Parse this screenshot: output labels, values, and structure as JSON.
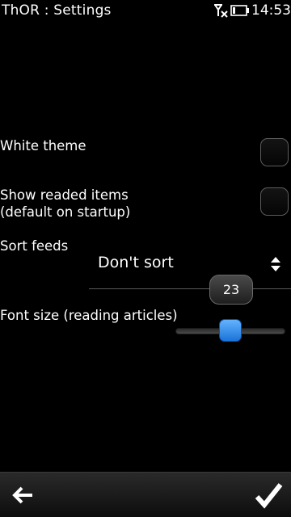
{
  "status_bar": {
    "app_title": "ThOR : Settings",
    "time": "14:53",
    "icons": [
      "signal-off-icon",
      "battery-icon"
    ]
  },
  "settings": {
    "white_theme": {
      "label": "White theme",
      "checked": false
    },
    "show_readed_items": {
      "label_line1": "Show readed items",
      "label_line2": "(default on startup)",
      "checked": false
    },
    "sort_feeds": {
      "label": "Sort feeds",
      "value": "Don't sort"
    },
    "font_size": {
      "label": "Font size (reading articles)",
      "value": "23",
      "level": 0.5
    }
  },
  "toolbar": {
    "back_icon": "back-arrow-icon",
    "ok_icon": "checkmark-icon"
  },
  "colors": {
    "background": "#000000",
    "slider_handle": "#2f8ff0",
    "text": "#ffffff"
  }
}
